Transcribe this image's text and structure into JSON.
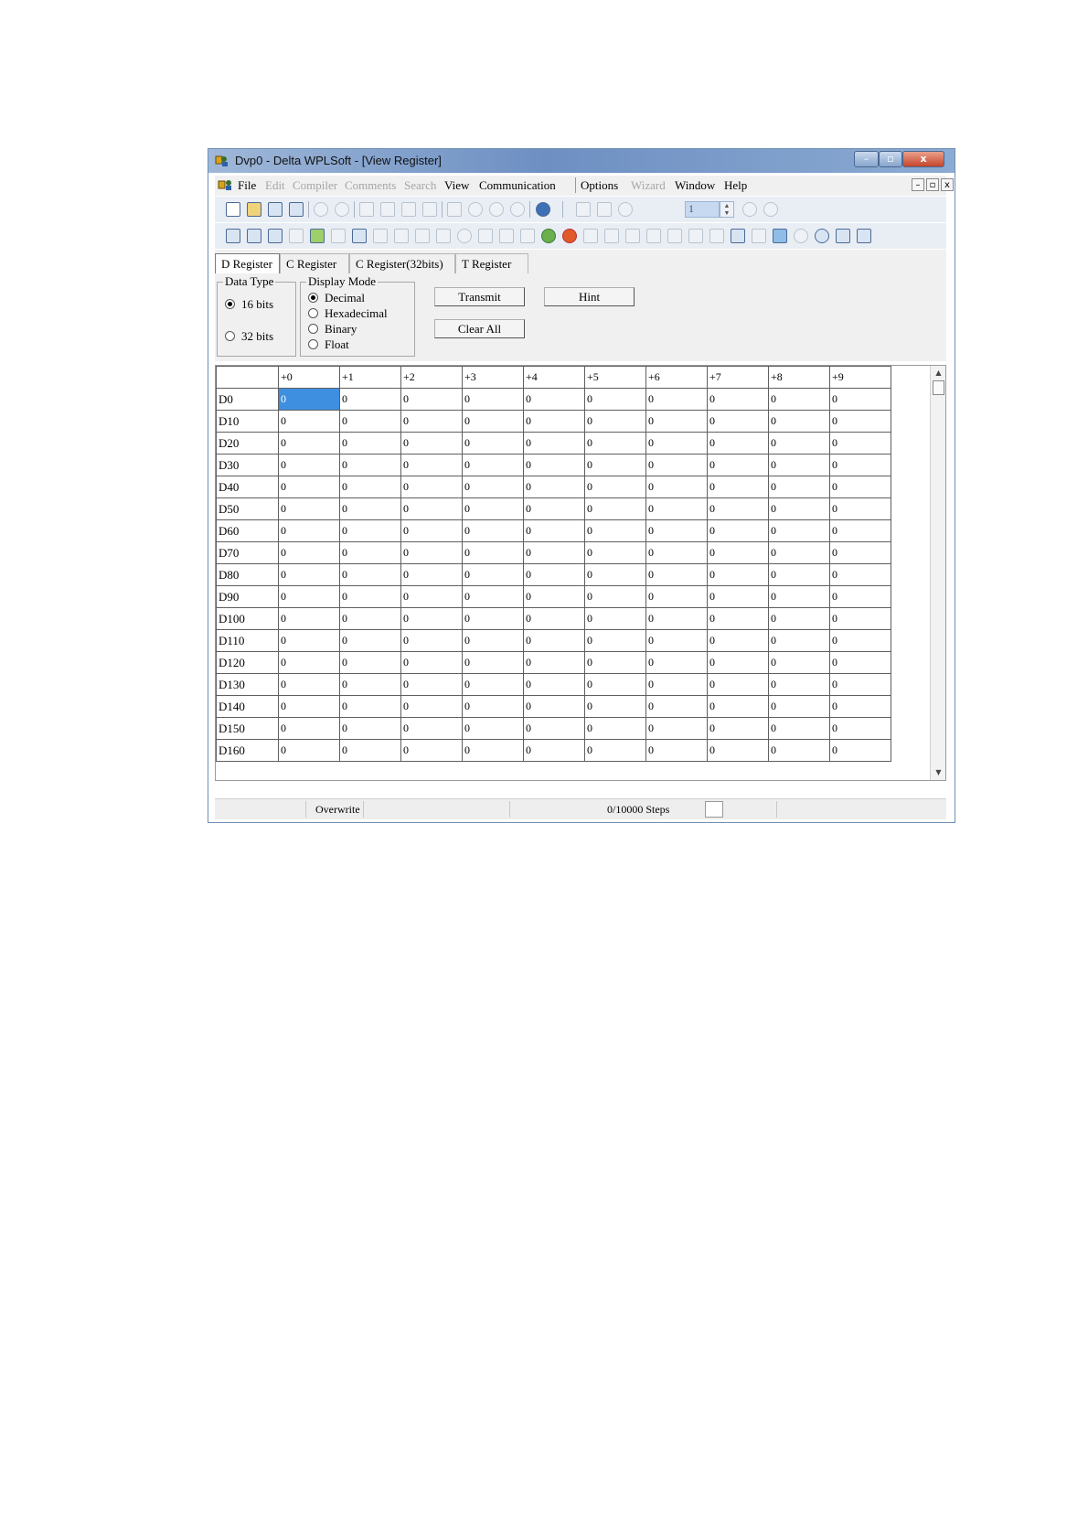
{
  "window": {
    "title": "Dvp0 - Delta WPLSoft - [View Register]",
    "caption_buttons": {
      "minimize": "–",
      "maximize": "▫",
      "close": "x"
    }
  },
  "menubar": {
    "items": [
      {
        "label": "File",
        "enabled": true
      },
      {
        "label": "Edit",
        "enabled": false
      },
      {
        "label": "Compiler",
        "enabled": false
      },
      {
        "label": "Comments",
        "enabled": false
      },
      {
        "label": "Search",
        "enabled": false
      },
      {
        "label": "View",
        "enabled": true
      },
      {
        "label": "Communication",
        "enabled": true
      },
      {
        "label": "Options",
        "enabled": true
      },
      {
        "label": "Wizard",
        "enabled": false
      },
      {
        "label": "Window",
        "enabled": true
      },
      {
        "label": "Help",
        "enabled": true
      }
    ],
    "mdi_buttons": {
      "minimize": "–",
      "restore": "▫",
      "close": "x"
    }
  },
  "toolbar": {
    "step_value": "1"
  },
  "tabs": [
    "D Register",
    "C Register",
    "C Register(32bits)",
    "T Register"
  ],
  "data_type": {
    "title": "Data Type",
    "options": [
      "16 bits",
      "32 bits"
    ],
    "selected": "16 bits"
  },
  "display_mode": {
    "title": "Display Mode",
    "options": [
      "Decimal",
      "Hexadecimal",
      "Binary",
      "Float"
    ],
    "selected": "Decimal"
  },
  "buttons": {
    "transmit": "Transmit",
    "hint": "Hint",
    "clear_all": "Clear All"
  },
  "grid": {
    "columns": [
      "+0",
      "+1",
      "+2",
      "+3",
      "+4",
      "+5",
      "+6",
      "+7",
      "+8",
      "+9"
    ],
    "rows": [
      {
        "label": "D0",
        "values": [
          "0",
          "0",
          "0",
          "0",
          "0",
          "0",
          "0",
          "0",
          "0",
          "0"
        ]
      },
      {
        "label": "D10",
        "values": [
          "0",
          "0",
          "0",
          "0",
          "0",
          "0",
          "0",
          "0",
          "0",
          "0"
        ]
      },
      {
        "label": "D20",
        "values": [
          "0",
          "0",
          "0",
          "0",
          "0",
          "0",
          "0",
          "0",
          "0",
          "0"
        ]
      },
      {
        "label": "D30",
        "values": [
          "0",
          "0",
          "0",
          "0",
          "0",
          "0",
          "0",
          "0",
          "0",
          "0"
        ]
      },
      {
        "label": "D40",
        "values": [
          "0",
          "0",
          "0",
          "0",
          "0",
          "0",
          "0",
          "0",
          "0",
          "0"
        ]
      },
      {
        "label": "D50",
        "values": [
          "0",
          "0",
          "0",
          "0",
          "0",
          "0",
          "0",
          "0",
          "0",
          "0"
        ]
      },
      {
        "label": "D60",
        "values": [
          "0",
          "0",
          "0",
          "0",
          "0",
          "0",
          "0",
          "0",
          "0",
          "0"
        ]
      },
      {
        "label": "D70",
        "values": [
          "0",
          "0",
          "0",
          "0",
          "0",
          "0",
          "0",
          "0",
          "0",
          "0"
        ]
      },
      {
        "label": "D80",
        "values": [
          "0",
          "0",
          "0",
          "0",
          "0",
          "0",
          "0",
          "0",
          "0",
          "0"
        ]
      },
      {
        "label": "D90",
        "values": [
          "0",
          "0",
          "0",
          "0",
          "0",
          "0",
          "0",
          "0",
          "0",
          "0"
        ]
      },
      {
        "label": "D100",
        "values": [
          "0",
          "0",
          "0",
          "0",
          "0",
          "0",
          "0",
          "0",
          "0",
          "0"
        ]
      },
      {
        "label": "D110",
        "values": [
          "0",
          "0",
          "0",
          "0",
          "0",
          "0",
          "0",
          "0",
          "0",
          "0"
        ]
      },
      {
        "label": "D120",
        "values": [
          "0",
          "0",
          "0",
          "0",
          "0",
          "0",
          "0",
          "0",
          "0",
          "0"
        ]
      },
      {
        "label": "D130",
        "values": [
          "0",
          "0",
          "0",
          "0",
          "0",
          "0",
          "0",
          "0",
          "0",
          "0"
        ]
      },
      {
        "label": "D140",
        "values": [
          "0",
          "0",
          "0",
          "0",
          "0",
          "0",
          "0",
          "0",
          "0",
          "0"
        ]
      },
      {
        "label": "D150",
        "values": [
          "0",
          "0",
          "0",
          "0",
          "0",
          "0",
          "0",
          "0",
          "0",
          "0"
        ]
      },
      {
        "label": "D160",
        "values": [
          "0",
          "0",
          "0",
          "0",
          "0",
          "0",
          "0",
          "0",
          "0",
          "0"
        ]
      }
    ],
    "selected_cell": {
      "row": "D0",
      "column": "+0"
    }
  },
  "statusbar": {
    "mode": "Overwrite",
    "steps": "0/10000 Steps"
  },
  "colors": {
    "title_bar": "#6d8fc2",
    "selected_cell": "#3f8fe0",
    "close_button": "#c6452a"
  }
}
